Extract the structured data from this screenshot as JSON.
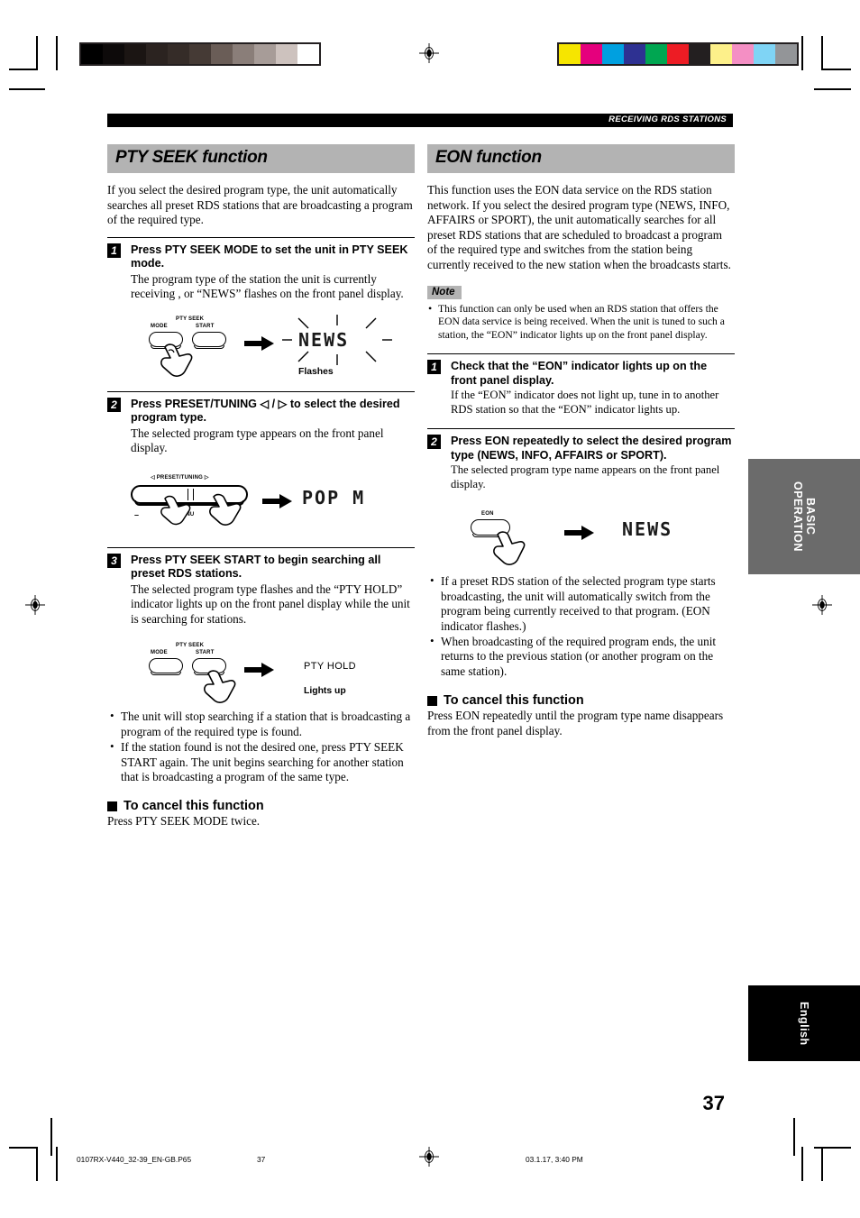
{
  "runhead": {
    "title": "RECEIVING RDS STATIONS"
  },
  "left_column": {
    "section_title": "PTY SEEK function",
    "intro": "If you select the desired program type, the unit automatically searches all preset RDS stations that are broadcasting a program of the required type.",
    "steps": [
      {
        "num": "1",
        "heading": "Press PTY SEEK MODE to set the unit in PTY SEEK mode.",
        "body": "The program type of the station the unit is currently receiving , or “NEWS” flashes on the front panel display.",
        "figure": {
          "group_label": "PTY SEEK",
          "button_left_label": "MODE",
          "button_right_label": "START",
          "display_text": "NEWS",
          "caption": "Flashes"
        }
      },
      {
        "num": "2",
        "heading": "Press PRESET/TUNING ◁ / ▷ to select the desired program type.",
        "body": "The selected program type appears on the front panel display.",
        "figure": {
          "rocker_label": "PRESET/TUNING",
          "rocker_minus": "–",
          "rocker_menu": "MENU",
          "display_text": "POP  M"
        }
      },
      {
        "num": "3",
        "heading": "Press PTY SEEK START to begin searching all preset RDS stations.",
        "body": "The selected program type flashes and the “PTY HOLD” indicator lights up on the front panel display while the unit is searching for stations.",
        "figure": {
          "group_label": "PTY SEEK",
          "button_left_label": "MODE",
          "button_right_label": "START",
          "display_text": "PTY HOLD",
          "caption": "Lights up"
        },
        "bullets": [
          "The unit will stop searching if a station that is broadcasting a program of the required type is found.",
          "If the station found is not the desired one, press PTY SEEK START again. The unit begins searching for another station that is broadcasting a program of the same type."
        ]
      }
    ],
    "cancel": {
      "heading": "To cancel this function",
      "body": "Press PTY SEEK MODE twice."
    }
  },
  "right_column": {
    "section_title": "EON function",
    "intro": "This function uses the EON data service on the RDS station network. If you select the desired program type (NEWS, INFO, AFFAIRS or SPORT), the unit automatically searches for all preset RDS stations that are scheduled to broadcast a program of the required type and switches from the station being currently received to the new station when the broadcasts starts.",
    "note_label": "Note",
    "note_bullets": [
      "This function can only be used when an RDS station that offers the EON data service is being received. When the unit is tuned to such a station, the “EON” indicator lights up on the front panel display."
    ],
    "steps": [
      {
        "num": "1",
        "heading": "Check that the “EON” indicator lights up on the front panel display.",
        "body": "If the “EON” indicator does not light up, tune in to another RDS station so that the “EON” indicator lights up."
      },
      {
        "num": "2",
        "heading": "Press EON repeatedly to select the desired program type (NEWS, INFO, AFFAIRS or SPORT).",
        "body": "The selected program type name appears on the front panel display.",
        "figure": {
          "button_label": "EON",
          "display_text": "NEWS"
        },
        "bullets": [
          "If a preset RDS station of the selected program type starts broadcasting, the unit will automatically switch from the program being currently received to that program. (EON indicator flashes.)",
          "When broadcasting of the required program ends, the unit returns to the previous station (or another program on the same station)."
        ]
      }
    ],
    "cancel": {
      "heading": "To cancel this function",
      "body": "Press EON repeatedly until the program type name disappears from the front panel display."
    }
  },
  "side_tabs": {
    "basic_operation": "BASIC\nOPERATION",
    "basic_operation_line1": "BASIC",
    "basic_operation_line2": "OPERATION",
    "english": "English"
  },
  "page_number": "37",
  "footer": {
    "filename": "0107RX-V440_32-39_EN-GB.P65",
    "page": "37",
    "timestamp": "03.1.17, 3:40 PM"
  },
  "calibration": {
    "gray_swatches": [
      "#000000",
      "#0d0a0a",
      "#1b1513",
      "#2b2320",
      "#352c28",
      "#453a35",
      "#6a5d57",
      "#8a7e79",
      "#a79c98",
      "#cdc2be",
      "#ffffff"
    ],
    "color_swatches": [
      "#f6e500",
      "#e5007d",
      "#00a0e0",
      "#2e3192",
      "#00a651",
      "#ed1c24",
      "#231f20",
      "#fdf08a",
      "#f48fc4",
      "#7fd4f5",
      "#939598"
    ]
  }
}
